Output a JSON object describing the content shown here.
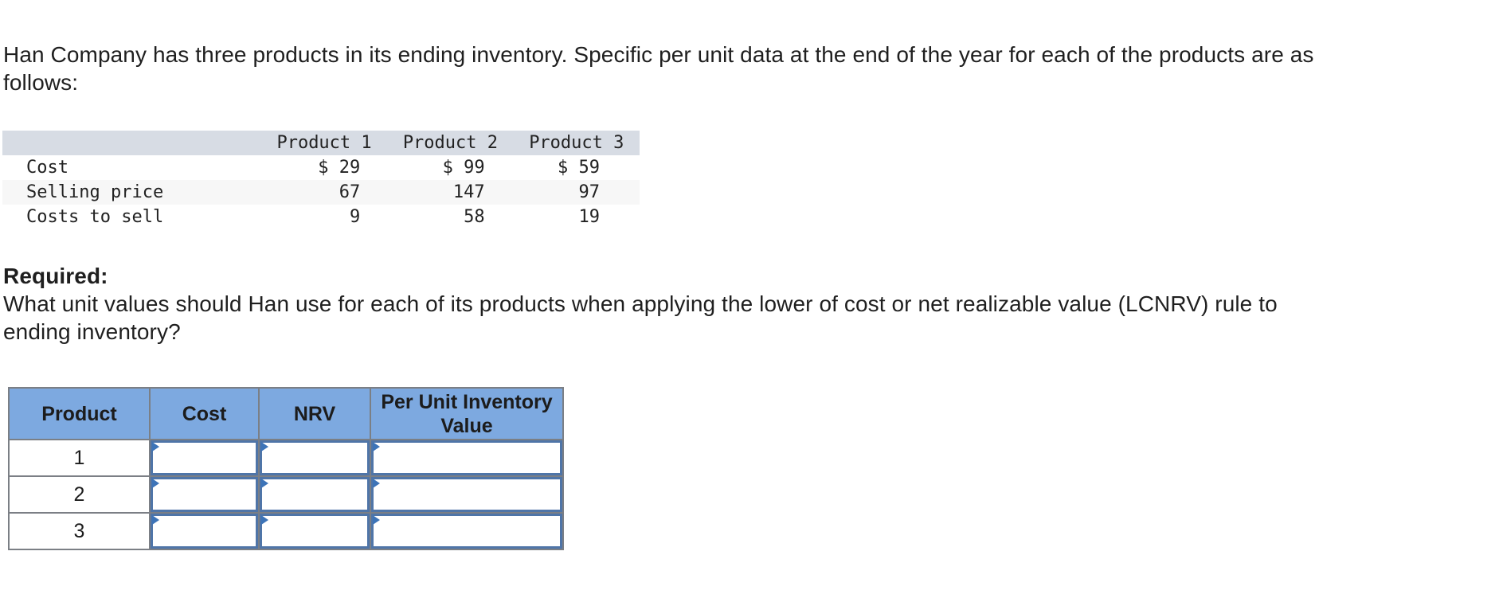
{
  "intro": {
    "lines": [
      "Han Company has three products in its ending inventory. Specific per unit data at the end of the year for each of the products are as",
      "follows:"
    ]
  },
  "data_table": {
    "headers": [
      "",
      "Product 1",
      "Product 2",
      "Product 3"
    ],
    "rows": [
      {
        "label": "Cost",
        "values": [
          "$ 29",
          "$ 99",
          "$ 59"
        ]
      },
      {
        "label": "Selling price",
        "values": [
          "67",
          "147",
          "97"
        ]
      },
      {
        "label": "Costs to sell",
        "values": [
          "9",
          "58",
          "19"
        ]
      }
    ]
  },
  "required": {
    "heading": "Required:",
    "question_lines": [
      "What unit values should Han use for each of its products when applying the lower of cost or net realizable value (LCNRV) rule to",
      "ending inventory?"
    ]
  },
  "answer_table": {
    "headers": {
      "product": "Product",
      "cost": "Cost",
      "nrv": "NRV",
      "value_line1": "Per Unit Inventory",
      "value_line2": "Value"
    },
    "rows": [
      {
        "product": "1",
        "cost": "",
        "nrv": "",
        "value": ""
      },
      {
        "product": "2",
        "cost": "",
        "nrv": "",
        "value": ""
      },
      {
        "product": "3",
        "cost": "",
        "nrv": "",
        "value": ""
      }
    ]
  },
  "colors": {
    "answer_header_bg": "#7da9e0",
    "data_header_bg": "#d7dce4",
    "input_border": "#4f75a8",
    "marker": "#3d74b8"
  }
}
